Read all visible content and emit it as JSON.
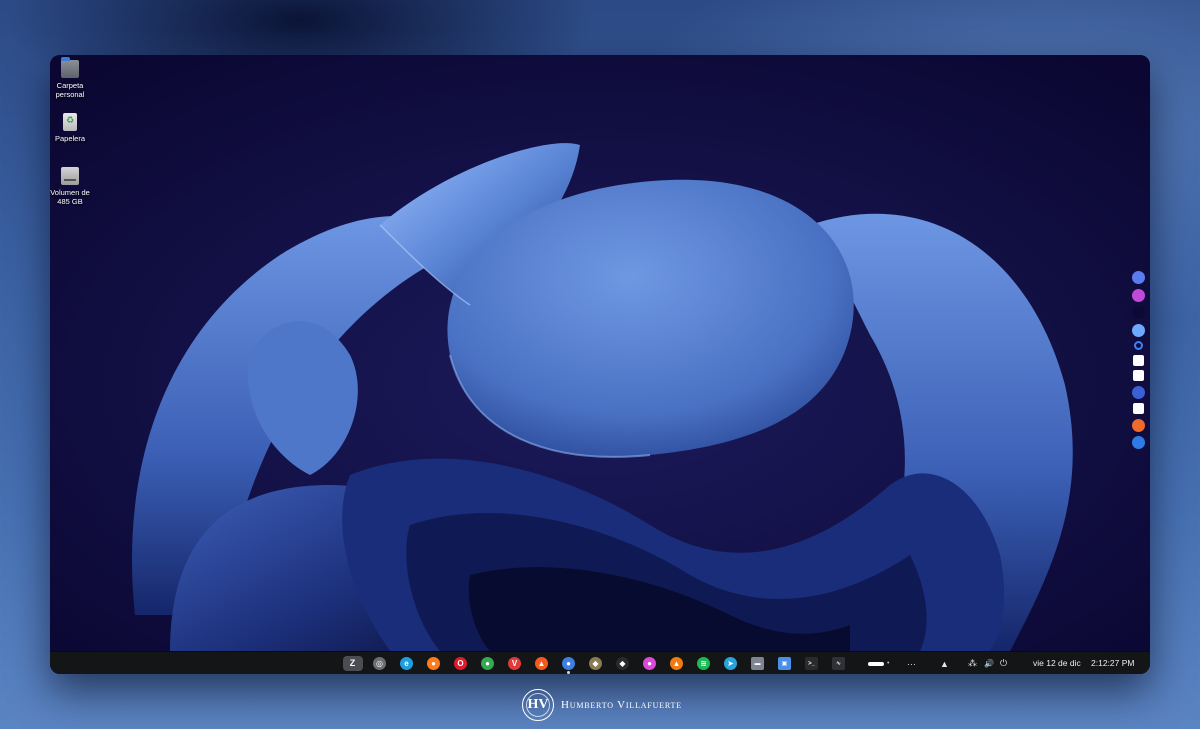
{
  "desktop": {
    "icons": [
      {
        "label": "Carpeta personal",
        "icon": "home-folder-icon"
      },
      {
        "label": "Papelera",
        "icon": "trash-icon"
      },
      {
        "label": "Volumen de 485 GB",
        "icon": "drive-icon"
      }
    ]
  },
  "side_dock": {
    "items": [
      {
        "icon": "copilot-icon",
        "color": "#5b7cf0"
      },
      {
        "icon": "loop-icon",
        "color": "#c04ad8"
      },
      {
        "icon": "blank-icon",
        "color": "#0d0935"
      },
      {
        "icon": "gemini-icon",
        "color": "#6fa8ff"
      },
      {
        "icon": "ring-icon",
        "color": "#3b83f6"
      },
      {
        "icon": "external-link-icon",
        "color": "#ffffff"
      },
      {
        "icon": "triangle-app-icon",
        "color": "#ffffff"
      },
      {
        "icon": "perplexity-icon",
        "color": "#3d5fd6"
      },
      {
        "icon": "c-app-icon",
        "color": "#ffffff"
      },
      {
        "icon": "orange-app-icon",
        "color": "#f06a2b"
      },
      {
        "icon": "blue-app-icon",
        "color": "#2f7be6"
      }
    ]
  },
  "taskbar": {
    "apps": [
      {
        "icon": "zorin-menu-icon",
        "glyph": "Z",
        "color": "#4b4d52"
      },
      {
        "icon": "circle-app-icon",
        "glyph": "◎",
        "color": "#6b6d72"
      },
      {
        "icon": "edge-icon",
        "glyph": "e",
        "color": "#1f9ede"
      },
      {
        "icon": "firefox-icon",
        "glyph": "●",
        "color": "#ff7a1a"
      },
      {
        "icon": "opera-icon",
        "glyph": "O",
        "color": "#e0192f"
      },
      {
        "icon": "chrome-icon",
        "glyph": "●",
        "color": "#34a853"
      },
      {
        "icon": "vivaldi-icon",
        "glyph": "V",
        "color": "#e03a3a"
      },
      {
        "icon": "brave-icon",
        "glyph": "▲",
        "color": "#f25a1e"
      },
      {
        "icon": "active-app-icon",
        "glyph": "●",
        "color": "#3d7fe0"
      },
      {
        "icon": "gimp-icon",
        "glyph": "◆",
        "color": "#8b7a52"
      },
      {
        "icon": "inkscape-icon",
        "glyph": "◆",
        "color": "#2a2a2a"
      },
      {
        "icon": "color-picker-icon",
        "glyph": "●",
        "color": "#d94ad8"
      },
      {
        "icon": "vlc-icon",
        "glyph": "▲",
        "color": "#f07c11"
      },
      {
        "icon": "spotify-icon",
        "glyph": "≋",
        "color": "#1db954"
      },
      {
        "icon": "telegram-icon",
        "glyph": "➤",
        "color": "#2aa3dc"
      },
      {
        "icon": "files-icon",
        "glyph": "▬",
        "color": "#7c8590"
      },
      {
        "icon": "software-store-icon",
        "glyph": "▣",
        "color": "#4a8fe8"
      },
      {
        "icon": "terminal-icon",
        "glyph": ">_",
        "color": "#2b2b2b"
      },
      {
        "icon": "system-monitor-icon",
        "glyph": "∿",
        "color": "#2f3136"
      }
    ],
    "active_app_index": 8,
    "tray": {
      "overflow_glyph": "···",
      "notification_glyph": "▲",
      "network_glyph": "⁂",
      "volume_glyph": "🔊",
      "power_glyph": "⏻"
    },
    "date": "vie 12 de dic",
    "time": "2:12:27 PM"
  },
  "watermark": {
    "seal_text": "HV",
    "name": "Humberto Villafuerte"
  }
}
